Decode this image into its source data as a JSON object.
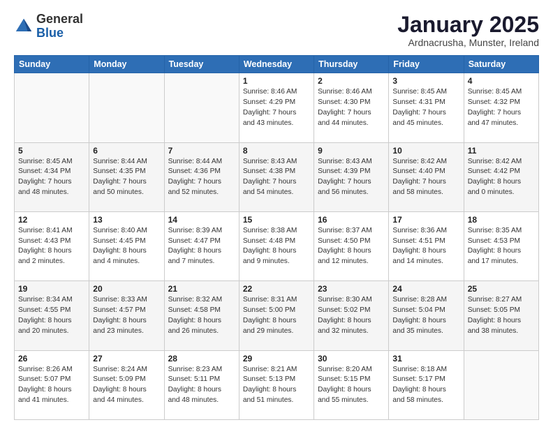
{
  "logo": {
    "general": "General",
    "blue": "Blue"
  },
  "header": {
    "title": "January 2025",
    "subtitle": "Ardnacrusha, Munster, Ireland"
  },
  "weekdays": [
    "Sunday",
    "Monday",
    "Tuesday",
    "Wednesday",
    "Thursday",
    "Friday",
    "Saturday"
  ],
  "weeks": [
    [
      {
        "day": "",
        "info": ""
      },
      {
        "day": "",
        "info": ""
      },
      {
        "day": "",
        "info": ""
      },
      {
        "day": "1",
        "info": "Sunrise: 8:46 AM\nSunset: 4:29 PM\nDaylight: 7 hours\nand 43 minutes."
      },
      {
        "day": "2",
        "info": "Sunrise: 8:46 AM\nSunset: 4:30 PM\nDaylight: 7 hours\nand 44 minutes."
      },
      {
        "day": "3",
        "info": "Sunrise: 8:45 AM\nSunset: 4:31 PM\nDaylight: 7 hours\nand 45 minutes."
      },
      {
        "day": "4",
        "info": "Sunrise: 8:45 AM\nSunset: 4:32 PM\nDaylight: 7 hours\nand 47 minutes."
      }
    ],
    [
      {
        "day": "5",
        "info": "Sunrise: 8:45 AM\nSunset: 4:34 PM\nDaylight: 7 hours\nand 48 minutes."
      },
      {
        "day": "6",
        "info": "Sunrise: 8:44 AM\nSunset: 4:35 PM\nDaylight: 7 hours\nand 50 minutes."
      },
      {
        "day": "7",
        "info": "Sunrise: 8:44 AM\nSunset: 4:36 PM\nDaylight: 7 hours\nand 52 minutes."
      },
      {
        "day": "8",
        "info": "Sunrise: 8:43 AM\nSunset: 4:38 PM\nDaylight: 7 hours\nand 54 minutes."
      },
      {
        "day": "9",
        "info": "Sunrise: 8:43 AM\nSunset: 4:39 PM\nDaylight: 7 hours\nand 56 minutes."
      },
      {
        "day": "10",
        "info": "Sunrise: 8:42 AM\nSunset: 4:40 PM\nDaylight: 7 hours\nand 58 minutes."
      },
      {
        "day": "11",
        "info": "Sunrise: 8:42 AM\nSunset: 4:42 PM\nDaylight: 8 hours\nand 0 minutes."
      }
    ],
    [
      {
        "day": "12",
        "info": "Sunrise: 8:41 AM\nSunset: 4:43 PM\nDaylight: 8 hours\nand 2 minutes."
      },
      {
        "day": "13",
        "info": "Sunrise: 8:40 AM\nSunset: 4:45 PM\nDaylight: 8 hours\nand 4 minutes."
      },
      {
        "day": "14",
        "info": "Sunrise: 8:39 AM\nSunset: 4:47 PM\nDaylight: 8 hours\nand 7 minutes."
      },
      {
        "day": "15",
        "info": "Sunrise: 8:38 AM\nSunset: 4:48 PM\nDaylight: 8 hours\nand 9 minutes."
      },
      {
        "day": "16",
        "info": "Sunrise: 8:37 AM\nSunset: 4:50 PM\nDaylight: 8 hours\nand 12 minutes."
      },
      {
        "day": "17",
        "info": "Sunrise: 8:36 AM\nSunset: 4:51 PM\nDaylight: 8 hours\nand 14 minutes."
      },
      {
        "day": "18",
        "info": "Sunrise: 8:35 AM\nSunset: 4:53 PM\nDaylight: 8 hours\nand 17 minutes."
      }
    ],
    [
      {
        "day": "19",
        "info": "Sunrise: 8:34 AM\nSunset: 4:55 PM\nDaylight: 8 hours\nand 20 minutes."
      },
      {
        "day": "20",
        "info": "Sunrise: 8:33 AM\nSunset: 4:57 PM\nDaylight: 8 hours\nand 23 minutes."
      },
      {
        "day": "21",
        "info": "Sunrise: 8:32 AM\nSunset: 4:58 PM\nDaylight: 8 hours\nand 26 minutes."
      },
      {
        "day": "22",
        "info": "Sunrise: 8:31 AM\nSunset: 5:00 PM\nDaylight: 8 hours\nand 29 minutes."
      },
      {
        "day": "23",
        "info": "Sunrise: 8:30 AM\nSunset: 5:02 PM\nDaylight: 8 hours\nand 32 minutes."
      },
      {
        "day": "24",
        "info": "Sunrise: 8:28 AM\nSunset: 5:04 PM\nDaylight: 8 hours\nand 35 minutes."
      },
      {
        "day": "25",
        "info": "Sunrise: 8:27 AM\nSunset: 5:05 PM\nDaylight: 8 hours\nand 38 minutes."
      }
    ],
    [
      {
        "day": "26",
        "info": "Sunrise: 8:26 AM\nSunset: 5:07 PM\nDaylight: 8 hours\nand 41 minutes."
      },
      {
        "day": "27",
        "info": "Sunrise: 8:24 AM\nSunset: 5:09 PM\nDaylight: 8 hours\nand 44 minutes."
      },
      {
        "day": "28",
        "info": "Sunrise: 8:23 AM\nSunset: 5:11 PM\nDaylight: 8 hours\nand 48 minutes."
      },
      {
        "day": "29",
        "info": "Sunrise: 8:21 AM\nSunset: 5:13 PM\nDaylight: 8 hours\nand 51 minutes."
      },
      {
        "day": "30",
        "info": "Sunrise: 8:20 AM\nSunset: 5:15 PM\nDaylight: 8 hours\nand 55 minutes."
      },
      {
        "day": "31",
        "info": "Sunrise: 8:18 AM\nSunset: 5:17 PM\nDaylight: 8 hours\nand 58 minutes."
      },
      {
        "day": "",
        "info": ""
      }
    ]
  ]
}
